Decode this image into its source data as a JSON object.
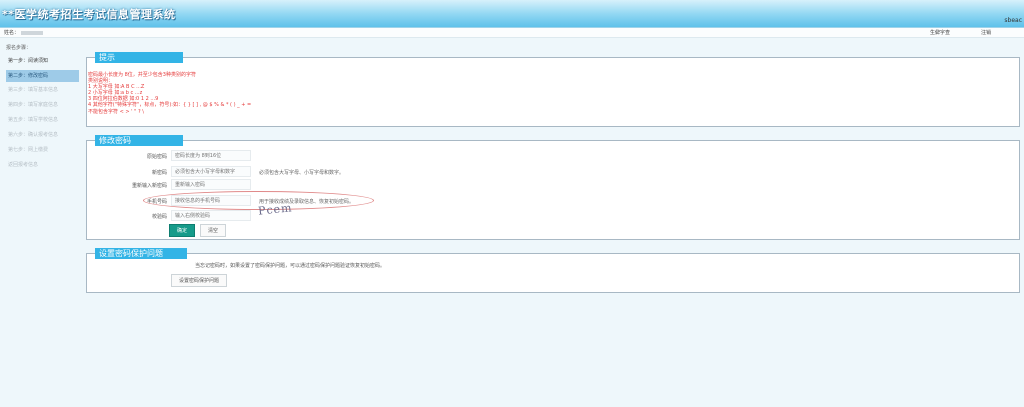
{
  "header": {
    "title": "**医学统考招生考试信息管理系统",
    "right_text": "sbeac"
  },
  "infobar": {
    "name_label": "姓名：",
    "user_label": "生僻字查",
    "logout_label": "注销"
  },
  "sidebar": {
    "steps_title": "报名步骤：",
    "steps": [
      {
        "label": "第一步：阅读须知"
      },
      {
        "label": "第二步：修改密码"
      },
      {
        "label": "第三步：填写基本信息"
      },
      {
        "label": "第四步：填写家庭信息"
      },
      {
        "label": "第五步：填写学校信息"
      },
      {
        "label": "第六步：确认报考信息"
      },
      {
        "label": "第七步：网上缴费"
      },
      {
        "label": "返回报考信息"
      }
    ]
  },
  "tips": {
    "title": "提示",
    "lines": [
      "密码最小长度为 8位，并至少包含3种类别的字符",
      "类别说明：",
      "1 大写字母 如:A B C ...Z",
      "2 小写字母 如:a b c ...z",
      "3 四位阿拉伯数据 如:0 1 2 ...9",
      "4 其他字符(\"特殊字符\"，标点，符号):如：{ } [ ] , @ $ % & * ( ) _ + =",
      "不能包含字符 < > ' \" ? \\"
    ]
  },
  "change_password": {
    "title": "修改密码",
    "fields": {
      "old": {
        "label": "原始密码",
        "placeholder": "密码长度为 8到16位",
        "hint": ""
      },
      "new": {
        "label": "新密码",
        "placeholder": "必须包含大小写字母和数字",
        "hint": "必须包含大写字母、小写字母和数字。"
      },
      "confirm": {
        "label": "重新输入新密码",
        "placeholder": "重新输入密码",
        "hint": ""
      },
      "phone": {
        "label": "手机号码",
        "placeholder": "接收信息的手机号码",
        "hint": "用于接收成绩及录取信息、恢复初始密码。"
      },
      "captcha": {
        "label": "校验码",
        "placeholder": "输入右侧校验码",
        "hint": ""
      }
    },
    "captcha_text": "Pcem",
    "confirm_button": "确定",
    "clear_button": "清空"
  },
  "protect": {
    "title": "设置密码保护问题",
    "text": "当忘记密码时，如果设置了密码保护问题，可以通过密码保护问题验证恢复初始密码。",
    "button": "设置密码保护问题"
  }
}
